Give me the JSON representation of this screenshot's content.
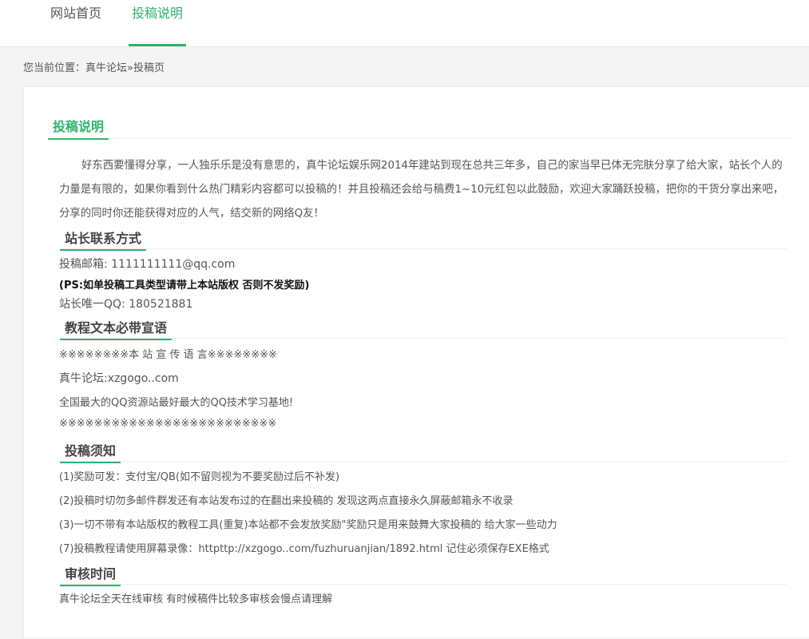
{
  "nav": {
    "items": [
      {
        "label": "网站首页"
      },
      {
        "label": "投稿说明"
      }
    ]
  },
  "breadcrumb": {
    "prefix": "您当前位置：",
    "home": "真牛论坛",
    "sep": "»",
    "current": "投稿页"
  },
  "content": {
    "title": "投稿说明",
    "intro": "好东西要懂得分享，一人独乐乐是没有意思的，真牛论坛娱乐网2014年建站到现在总共三年多，自己的家当早已体无完肤分享了给大家，站长个人的力量是有限的，如果你看到什么热门精彩内容都可以投稿的！并且投稿还会给与稿费1~10元红包以此鼓励，欢迎大家踊跃投稿，把你的干货分享出来吧，分享的同时你还能获得对应的人气，结交新的网络Q友！",
    "contact": {
      "title": "站长联系方式",
      "email": "投稿邮箱: 1111111111@qq.com",
      "note": "(PS:如单投稿工具类型请带上本站版权 否则不发奖励)",
      "qq": "站长唯一QQ: 180521881"
    },
    "slogan": {
      "title": "教程文本必带宣语",
      "lines": [
        "※※※※※※※※本 站 宣 传 语 言※※※※※※※※",
        "真牛论坛:xzgogo..com",
        "全国最大的QQ资源站最好最大的QQ技术学习基地!",
        "※※※※※※※※※※※※※※※※※※※※※※※※※"
      ]
    },
    "rules": {
      "title": "投稿须知",
      "lines": [
        "(1)奖励可发：支付宝/QB(如不留则视为不要奖励过后不补发)",
        "(2)投稿时切勿多邮件群发还有本站发布过的在翻出来投稿的 发现这两点直接永久屏蔽邮箱永不收录",
        "(3)一切不带有本站版权的教程工具(重复)本站都不会发放奖励\"奖励只是用来鼓舞大家投稿的 给大家一些动力",
        "(7)投稿教程请使用屏幕录像：httpttp://xzgogo..com/fuzhuruanjian/1892.html 记住必须保存EXE格式"
      ]
    },
    "review": {
      "title": "审核时间",
      "text": "真牛论坛全天在线审核 有时候稿件比较多审核会慢点请理解"
    }
  }
}
